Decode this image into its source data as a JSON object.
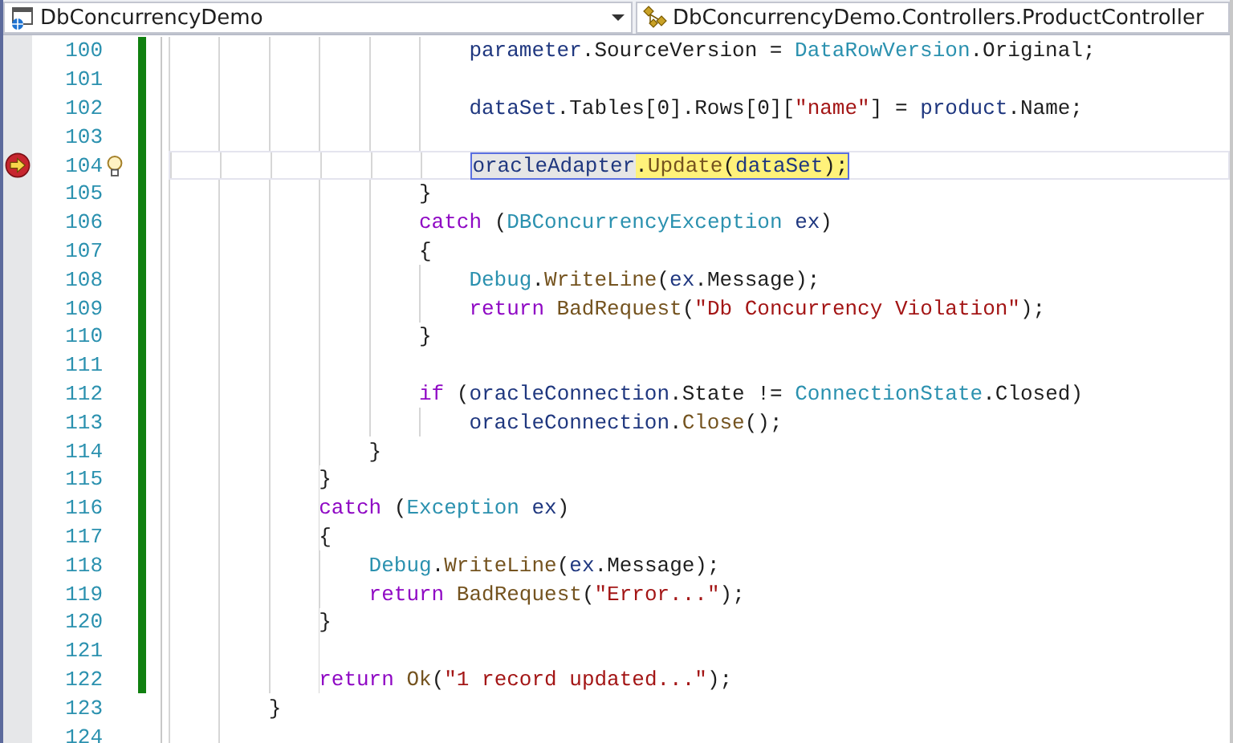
{
  "navigation_bar": {
    "project_dropdown": {
      "value": "DbConcurrencyDemo"
    },
    "type_dropdown": {
      "value": "DbConcurrencyDemo.Controllers.ProductController"
    }
  },
  "code_lines": [
    {
      "children": [
        {
          "children": [
            {
              "children": [
                {
                  "children": [
                    {
                      "children": [
                        {
                          "number": "100",
                          "changed": true,
                          "tokens": [
                            {
                              "text": "parameter",
                              "kind": "variable"
                            },
                            {
                              "text": ".SourceVersion = ",
                              "kind": "plain"
                            },
                            {
                              "text": "DataRowVersion",
                              "kind": "type"
                            },
                            {
                              "text": ".Original;",
                              "kind": "plain"
                            }
                          ]
                        },
                        {
                          "number": "101",
                          "changed": true
                        },
                        {
                          "number": "102",
                          "changed": true,
                          "tokens": [
                            {
                              "text": "dataSet",
                              "kind": "variable"
                            },
                            {
                              "text": ".Tables[0].Rows[0][",
                              "kind": "plain"
                            },
                            {
                              "text": "\"name\"",
                              "kind": "string"
                            },
                            {
                              "text": "] = ",
                              "kind": "plain"
                            },
                            {
                              "text": "product",
                              "kind": "variable"
                            },
                            {
                              "text": ".Name;",
                              "kind": "plain"
                            }
                          ]
                        },
                        {
                          "number": "103",
                          "changed": true
                        },
                        {
                          "number": "104",
                          "changed": true,
                          "execution": true,
                          "lightbulb": true,
                          "tokens": [
                            {
                              "text": "oracleAdapter",
                              "kind": "variable",
                              "reference": true,
                              "executing": false
                            },
                            {
                              "text": ".",
                              "kind": "plain",
                              "executing": true
                            },
                            {
                              "text": "Update",
                              "kind": "method",
                              "executing": true
                            },
                            {
                              "text": "(",
                              "kind": "plain",
                              "executing": true
                            },
                            {
                              "text": "dataSet",
                              "kind": "variable",
                              "executing": true
                            },
                            {
                              "text": ");",
                              "kind": "plain",
                              "executing": true
                            }
                          ]
                        }
                      ]
                    },
                    {
                      "number": "105",
                      "changed": true,
                      "tokens": [
                        {
                          "text": "}",
                          "kind": "plain"
                        }
                      ]
                    },
                    {
                      "number": "106",
                      "changed": true,
                      "tokens": [
                        {
                          "text": "catch",
                          "kind": "keyword"
                        },
                        {
                          "text": " (",
                          "kind": "plain"
                        },
                        {
                          "text": "DBConcurrencyException",
                          "kind": "type"
                        },
                        {
                          "text": " ex",
                          "kind": "variable"
                        },
                        {
                          "text": ")",
                          "kind": "plain"
                        }
                      ]
                    },
                    {
                      "number": "107",
                      "changed": true,
                      "tokens": [
                        {
                          "text": "{",
                          "kind": "plain"
                        }
                      ]
                    },
                    {
                      "children": [
                        {
                          "number": "108",
                          "changed": true,
                          "tokens": [
                            {
                              "text": "Debug",
                              "kind": "type"
                            },
                            {
                              "text": ".",
                              "kind": "plain"
                            },
                            {
                              "text": "WriteLine",
                              "kind": "method"
                            },
                            {
                              "text": "(",
                              "kind": "plain"
                            },
                            {
                              "text": "ex",
                              "kind": "variable"
                            },
                            {
                              "text": ".Message);",
                              "kind": "plain"
                            }
                          ]
                        },
                        {
                          "number": "109",
                          "changed": true,
                          "tokens": [
                            {
                              "text": "return",
                              "kind": "keyword"
                            },
                            {
                              "text": " BadRequest",
                              "kind": "method"
                            },
                            {
                              "text": "(",
                              "kind": "plain"
                            },
                            {
                              "text": "\"Db Concurrency Violation\"",
                              "kind": "string"
                            },
                            {
                              "text": ");",
                              "kind": "plain"
                            }
                          ]
                        }
                      ]
                    },
                    {
                      "number": "110",
                      "changed": true,
                      "tokens": [
                        {
                          "text": "}",
                          "kind": "plain"
                        }
                      ]
                    },
                    {
                      "number": "111",
                      "changed": true
                    },
                    {
                      "number": "112",
                      "changed": true,
                      "tokens": [
                        {
                          "text": "if",
                          "kind": "keyword"
                        },
                        {
                          "text": " (",
                          "kind": "plain"
                        },
                        {
                          "text": "oracleConnection",
                          "kind": "variable"
                        },
                        {
                          "text": ".State != ",
                          "kind": "plain"
                        },
                        {
                          "text": "ConnectionState",
                          "kind": "type"
                        },
                        {
                          "text": ".Closed)",
                          "kind": "plain"
                        }
                      ]
                    },
                    {
                      "children": [
                        {
                          "number": "113",
                          "changed": true,
                          "tokens": [
                            {
                              "text": "oracleConnection",
                              "kind": "variable"
                            },
                            {
                              "text": ".",
                              "kind": "plain"
                            },
                            {
                              "text": "Close",
                              "kind": "method"
                            },
                            {
                              "text": "();",
                              "kind": "plain"
                            }
                          ]
                        }
                      ]
                    }
                  ]
                },
                {
                  "number": "114",
                  "changed": true,
                  "tokens": [
                    {
                      "text": "}",
                      "kind": "plain"
                    }
                  ]
                }
              ]
            },
            {
              "number": "115",
              "changed": true,
              "tokens": [
                {
                  "text": "}",
                  "kind": "plain"
                }
              ]
            },
            {
              "number": "116",
              "changed": true,
              "tokens": [
                {
                  "text": "catch",
                  "kind": "keyword"
                },
                {
                  "text": " (",
                  "kind": "plain"
                },
                {
                  "text": "Exception",
                  "kind": "type"
                },
                {
                  "text": " ex",
                  "kind": "variable"
                },
                {
                  "text": ")",
                  "kind": "plain"
                }
              ]
            },
            {
              "number": "117",
              "changed": true,
              "tokens": [
                {
                  "text": "{",
                  "kind": "plain"
                }
              ]
            },
            {
              "children": [
                {
                  "number": "118",
                  "changed": true,
                  "tokens": [
                    {
                      "text": "Debug",
                      "kind": "type"
                    },
                    {
                      "text": ".",
                      "kind": "plain"
                    },
                    {
                      "text": "WriteLine",
                      "kind": "method"
                    },
                    {
                      "text": "(",
                      "kind": "plain"
                    },
                    {
                      "text": "ex",
                      "kind": "variable"
                    },
                    {
                      "text": ".Message);",
                      "kind": "plain"
                    }
                  ]
                },
                {
                  "number": "119",
                  "changed": true,
                  "tokens": [
                    {
                      "text": "return",
                      "kind": "keyword"
                    },
                    {
                      "text": " BadRequest",
                      "kind": "method"
                    },
                    {
                      "text": "(",
                      "kind": "plain"
                    },
                    {
                      "text": "\"Error...\"",
                      "kind": "string"
                    },
                    {
                      "text": ");",
                      "kind": "plain"
                    }
                  ]
                }
              ]
            },
            {
              "number": "120",
              "changed": true,
              "tokens": [
                {
                  "text": "}",
                  "kind": "plain"
                }
              ]
            },
            {
              "number": "121",
              "changed": true
            },
            {
              "number": "122",
              "changed": true,
              "tokens": [
                {
                  "text": "return",
                  "kind": "keyword"
                },
                {
                  "text": " Ok",
                  "kind": "method"
                },
                {
                  "text": "(",
                  "kind": "plain"
                },
                {
                  "text": "\"1 record updated...\"",
                  "kind": "string"
                },
                {
                  "text": ");",
                  "kind": "plain"
                }
              ]
            }
          ]
        },
        {
          "number": "123",
          "changed": false,
          "tokens": [
            {
              "text": "}",
              "kind": "plain"
            }
          ]
        },
        {
          "number": "124",
          "changed": false
        }
      ]
    }
  ]
}
